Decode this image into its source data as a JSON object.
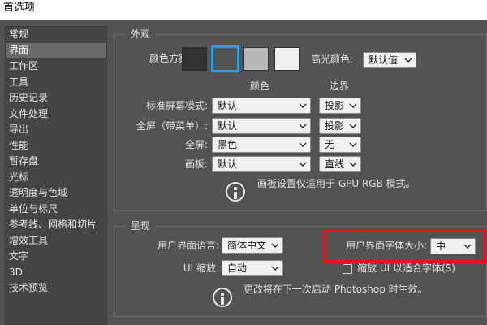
{
  "window": {
    "title": "首选项"
  },
  "sidebar": {
    "items": [
      {
        "label": "常规",
        "selected": false
      },
      {
        "label": "界面",
        "selected": true
      },
      {
        "label": "工作区",
        "selected": false
      },
      {
        "label": "工具",
        "selected": false
      },
      {
        "label": "历史记录",
        "selected": false
      },
      {
        "label": "文件处理",
        "selected": false
      },
      {
        "label": "导出",
        "selected": false
      },
      {
        "label": "性能",
        "selected": false
      },
      {
        "label": "暂存盘",
        "selected": false
      },
      {
        "label": "光标",
        "selected": false
      },
      {
        "label": "透明度与色域",
        "selected": false
      },
      {
        "label": "单位与标尺",
        "selected": false
      },
      {
        "label": "参考线、网格和切片",
        "selected": false
      },
      {
        "label": "增效工具",
        "selected": false
      },
      {
        "label": "文字",
        "selected": false
      },
      {
        "label": "3D",
        "selected": false
      },
      {
        "label": "技术预览",
        "selected": false
      }
    ]
  },
  "appearance": {
    "group_label": "外观",
    "color_scheme_label": "颜色方案:",
    "swatch_colors": [
      "#323232",
      "#535353",
      "#b8b8b8",
      "#f0f0f0"
    ],
    "selected_swatch": 1,
    "highlight_color_label": "高光颜色:",
    "highlight_color_value": "默认值",
    "col_color": "颜色",
    "col_border": "边界",
    "rows": [
      {
        "label": "标准屏幕模式:",
        "color": "默认",
        "border": "投影"
      },
      {
        "label": "全屏（带菜单）:",
        "color": "默认",
        "border": "投影"
      },
      {
        "label": "全屏:",
        "color": "黑色",
        "border": "无"
      },
      {
        "label": "画板:",
        "color": "默认",
        "border": "直线"
      }
    ],
    "note": "画板设置仅适用于 GPU RGB 模式。"
  },
  "presentation": {
    "group_label": "呈现",
    "ui_language_label": "用户界面语言:",
    "ui_language_value": "简体中文",
    "ui_font_size_label": "用户界面字体大小:",
    "ui_font_size_value": "中",
    "ui_scale_label": "UI 缩放:",
    "ui_scale_value": "自动",
    "scale_checkbox_label": "缩放 UI 以适合字体(S)",
    "scale_checkbox_checked": false,
    "note": "更改将在下一次启动 Photoshop 时生效。"
  },
  "colors": {
    "highlight_box": "#e0141a",
    "selected_swatch_outline": "#2f9ee6"
  }
}
